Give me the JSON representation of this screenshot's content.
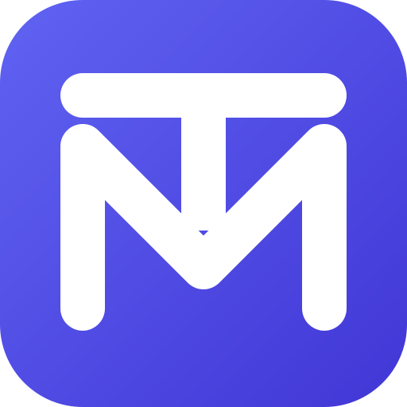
{
  "icon": {
    "name": "tm-monogram-app-icon",
    "colors": {
      "gradient_start": "#6063F2",
      "gradient_end": "#4136D6",
      "glyph": "#FFFFFF"
    }
  }
}
